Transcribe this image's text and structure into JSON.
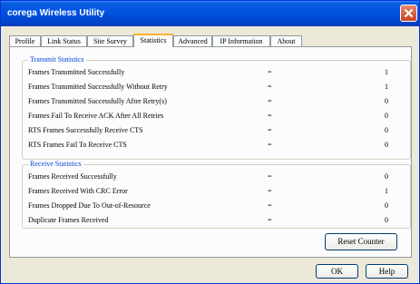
{
  "window": {
    "title": "corega Wireless Utility"
  },
  "tabs": [
    {
      "label": "Profile"
    },
    {
      "label": "Link Status"
    },
    {
      "label": "Site Survey"
    },
    {
      "label": "Statistics"
    },
    {
      "label": "Advanced"
    },
    {
      "label": "IP Information"
    },
    {
      "label": "About"
    }
  ],
  "active_tab": "Statistics",
  "transmit": {
    "title": "Transmit Statistics",
    "rows": [
      {
        "label": "Frames Transmitted Successfully",
        "sep": "=",
        "value": "1"
      },
      {
        "label": "Frames Transmitted Successfully  Without Retry",
        "sep": "=",
        "value": "1"
      },
      {
        "label": "Frames Transmitted Successfully After Retry(s)",
        "sep": "=",
        "value": "0"
      },
      {
        "label": "Frames Fail To Receive ACK After All Retries",
        "sep": "=",
        "value": "0"
      },
      {
        "label": "RTS Frames Successfully Receive CTS",
        "sep": "=",
        "value": "0"
      },
      {
        "label": "RTS Frames Fail To Receive CTS",
        "sep": "=",
        "value": "0"
      }
    ]
  },
  "receive": {
    "title": "Receive Statistics",
    "rows": [
      {
        "label": "Frames Received Successfully",
        "sep": "=",
        "value": "0"
      },
      {
        "label": "Frames Received With CRC Error",
        "sep": "=",
        "value": "1"
      },
      {
        "label": "Frames Dropped Due To Out-of-Resource",
        "sep": "=",
        "value": "0"
      },
      {
        "label": "Duplicate Frames Received",
        "sep": "=",
        "value": "0"
      }
    ]
  },
  "buttons": {
    "reset": "Reset Counter",
    "ok": "OK",
    "help": "Help"
  },
  "icons": {
    "close": "close-icon"
  },
  "colors": {
    "titlebar": "#0054e3",
    "group_title": "#0046d5",
    "close": "#c9451f"
  }
}
